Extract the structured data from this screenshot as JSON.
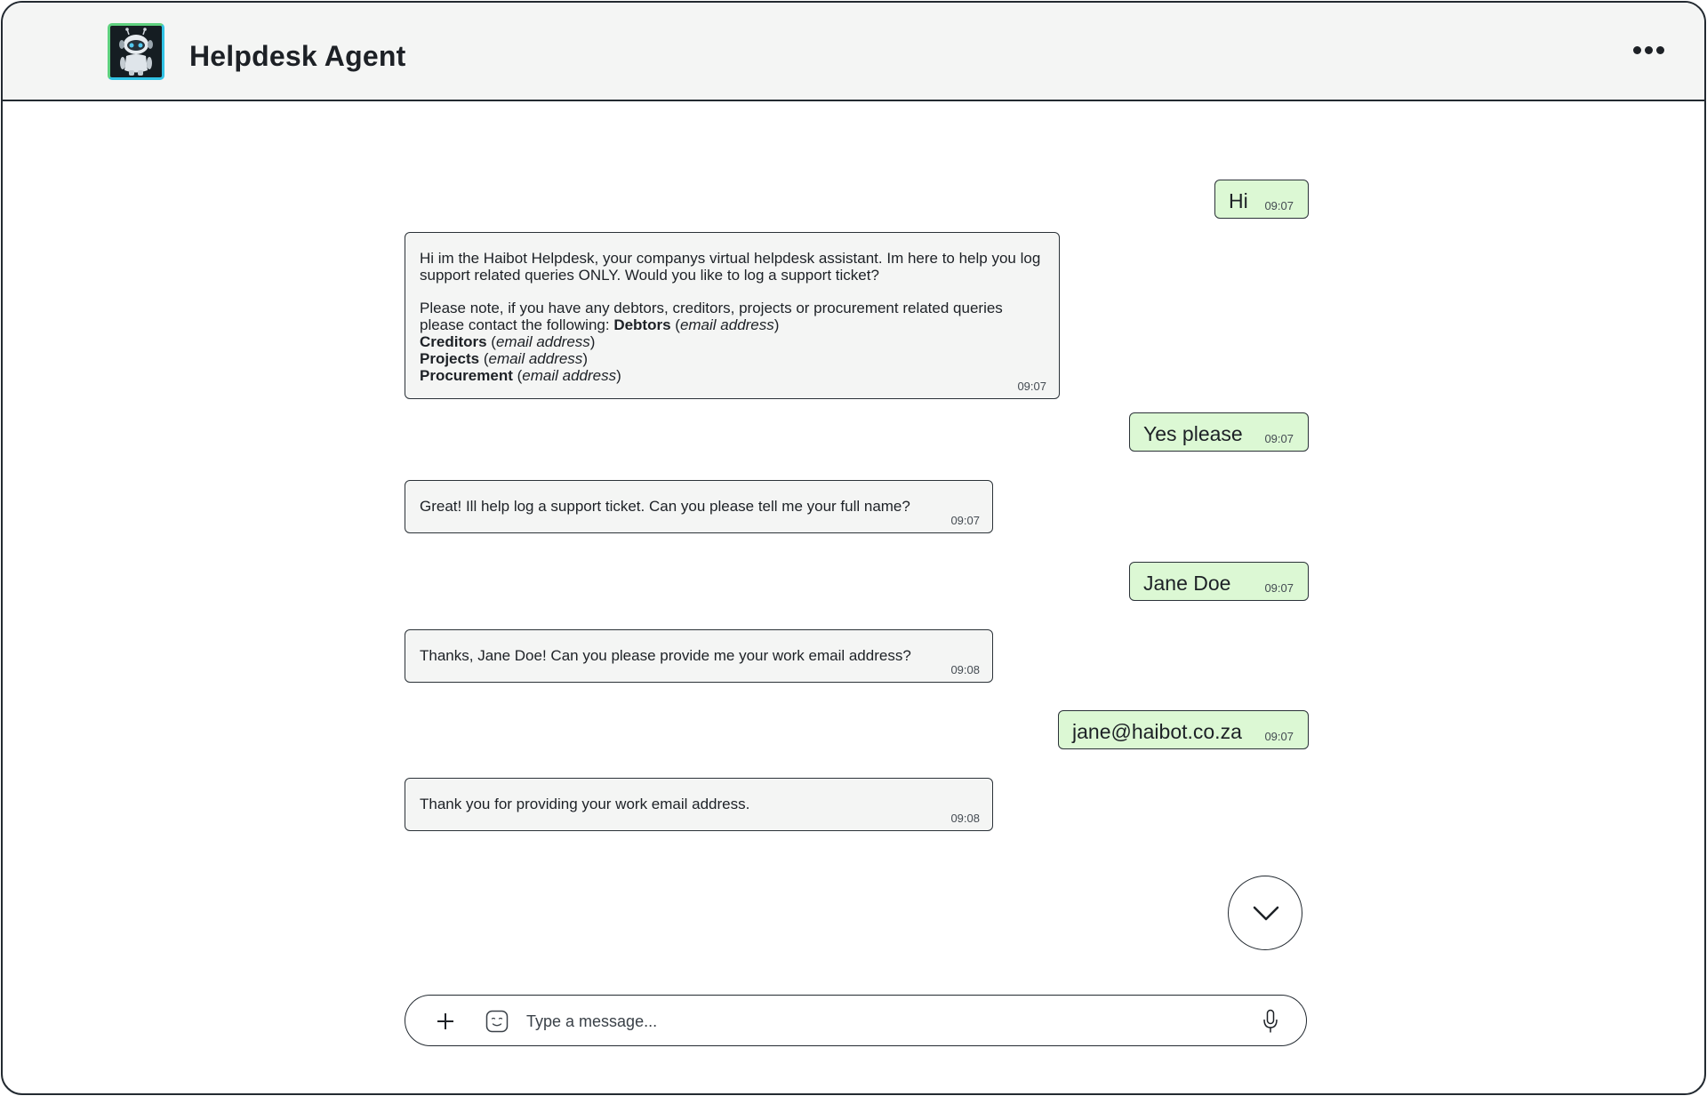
{
  "header": {
    "title": "Helpdesk Agent",
    "avatar_icon": "robot-icon",
    "menu_icon": "more-horizontal-icon"
  },
  "messages": [
    {
      "sender": "user",
      "text": "Hi",
      "time": "09:07"
    },
    {
      "sender": "bot",
      "p1": "Hi im the Haibot Helpdesk, your companys virtual helpdesk assistant. Im here to help you log support related queries ONLY. Would you like to log a support ticket?",
      "p2_intro": "Please note, if you have any debtors, creditors, projects or procurement related queries please contact the following: ",
      "contacts": [
        {
          "label": "Debtors",
          "value": "email address"
        },
        {
          "label": "Creditors",
          "value": "email address"
        },
        {
          "label": "Projects",
          "value": "email address"
        },
        {
          "label": "Procurement",
          "value": "email address"
        }
      ],
      "time": "09:07"
    },
    {
      "sender": "user",
      "text": "Yes please",
      "time": "09:07"
    },
    {
      "sender": "bot",
      "text": "Great! Ill help log a support ticket. Can you please tell me your full name?",
      "time": "09:07"
    },
    {
      "sender": "user",
      "text": "Jane Doe",
      "time": "09:07"
    },
    {
      "sender": "bot",
      "text": "Thanks, Jane Doe! Can you please provide me your work email address?",
      "time": "09:08"
    },
    {
      "sender": "user",
      "text": "jane@haibot.co.za",
      "time": "09:07"
    },
    {
      "sender": "bot",
      "text": "Thank you for providing your work email address.",
      "time": "09:08"
    }
  ],
  "composer": {
    "placeholder": "Type a message...",
    "value": "",
    "icons": [
      "plus-icon",
      "emoji-icon",
      "microphone-icon"
    ]
  },
  "scroll_button_icon": "chevron-down-icon",
  "colors": {
    "bot_bubble": "#f4f5f4",
    "user_bubble": "#dcf8d4",
    "border": "#232a31",
    "avatar_border_green": "#5fd17f",
    "avatar_border_cyan": "#31c3e6"
  }
}
